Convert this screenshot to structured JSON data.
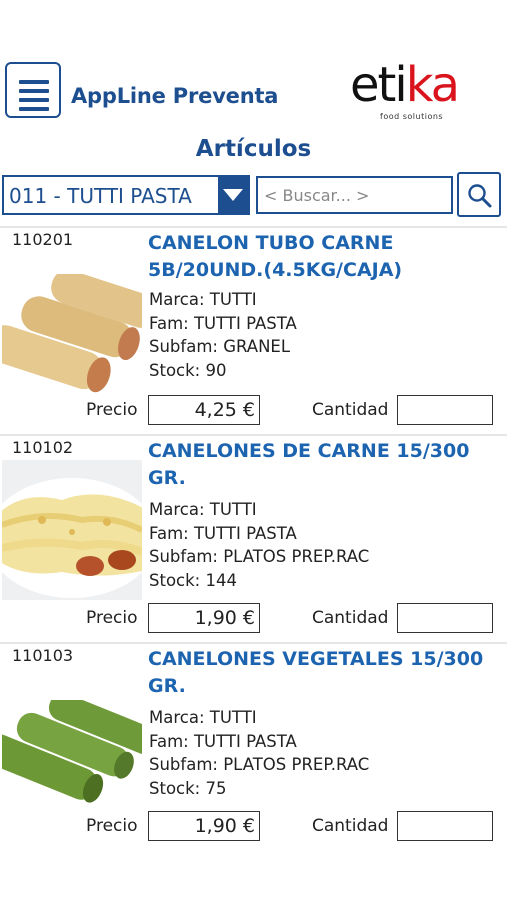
{
  "header": {
    "app_title": "AppLine Preventa",
    "logo_text_dark": "eti",
    "logo_text_red": "ka",
    "logo_tagline": "food solutions"
  },
  "page_title": "Artículos",
  "filter": {
    "family_selected": "011 - TUTTI PASTA",
    "search_placeholder": "< Buscar... >"
  },
  "labels": {
    "price": "Precio",
    "quantity": "Cantidad"
  },
  "products": [
    {
      "code": "110201",
      "name": "CANELON TUBO CARNE 5B/20UND.(4.5KG/CAJA)",
      "marca": "Marca: TUTTI",
      "fam": "Fam: TUTTI PASTA",
      "subfam": "Subfam: GRANEL",
      "stock": "Stock: 90",
      "price": "4,25 €"
    },
    {
      "code": "110102",
      "name": "CANELONES DE CARNE 15/300 GR.",
      "marca": "Marca: TUTTI",
      "fam": "Fam: TUTTI PASTA",
      "subfam": "Subfam: PLATOS PREP.RAC",
      "stock": "Stock: 144",
      "price": "1,90 €"
    },
    {
      "code": "110103",
      "name": "CANELONES VEGETALES 15/300 GR.",
      "marca": "Marca: TUTTI",
      "fam": "Fam: TUTTI PASTA",
      "subfam": "Subfam: PLATOS PREP.RAC",
      "stock": "Stock: 75",
      "price": "1,90 €"
    }
  ]
}
